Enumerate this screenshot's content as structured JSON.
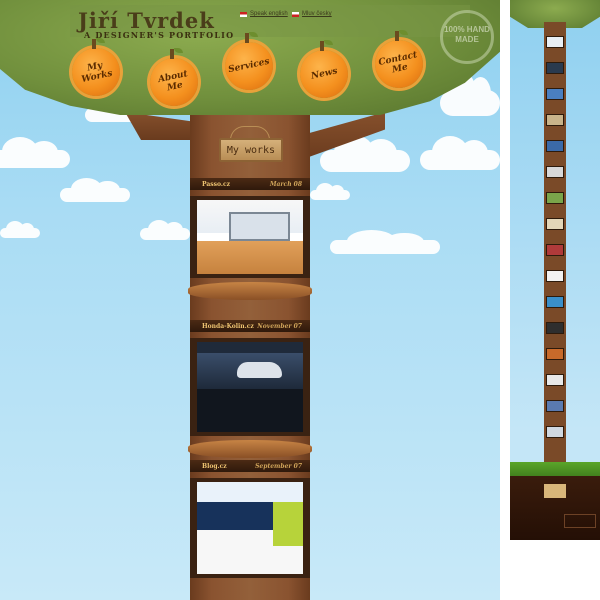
{
  "header": {
    "title": "Jiří Tvrdek",
    "subtitle": "A DESIGNER'S PORTFOLIO",
    "languages": [
      "Speak english",
      "Mluv česky"
    ],
    "badge": "100% HAND MADE"
  },
  "nav": [
    "My Works",
    "About Me",
    "Services",
    "News",
    "Contact Me"
  ],
  "section_sign": "My works",
  "works": [
    {
      "name": "Passo.cz",
      "month": "March 08"
    },
    {
      "name": "Honda-Kolin.cz",
      "month": "November 07"
    },
    {
      "name": "Blog.cz",
      "month": "September 07"
    }
  ],
  "colors": {
    "sky": "#a9dcf4",
    "leaves": "#71903d",
    "trunk": "#8a5330",
    "orange": "#f4901e",
    "label": "#efc472"
  }
}
